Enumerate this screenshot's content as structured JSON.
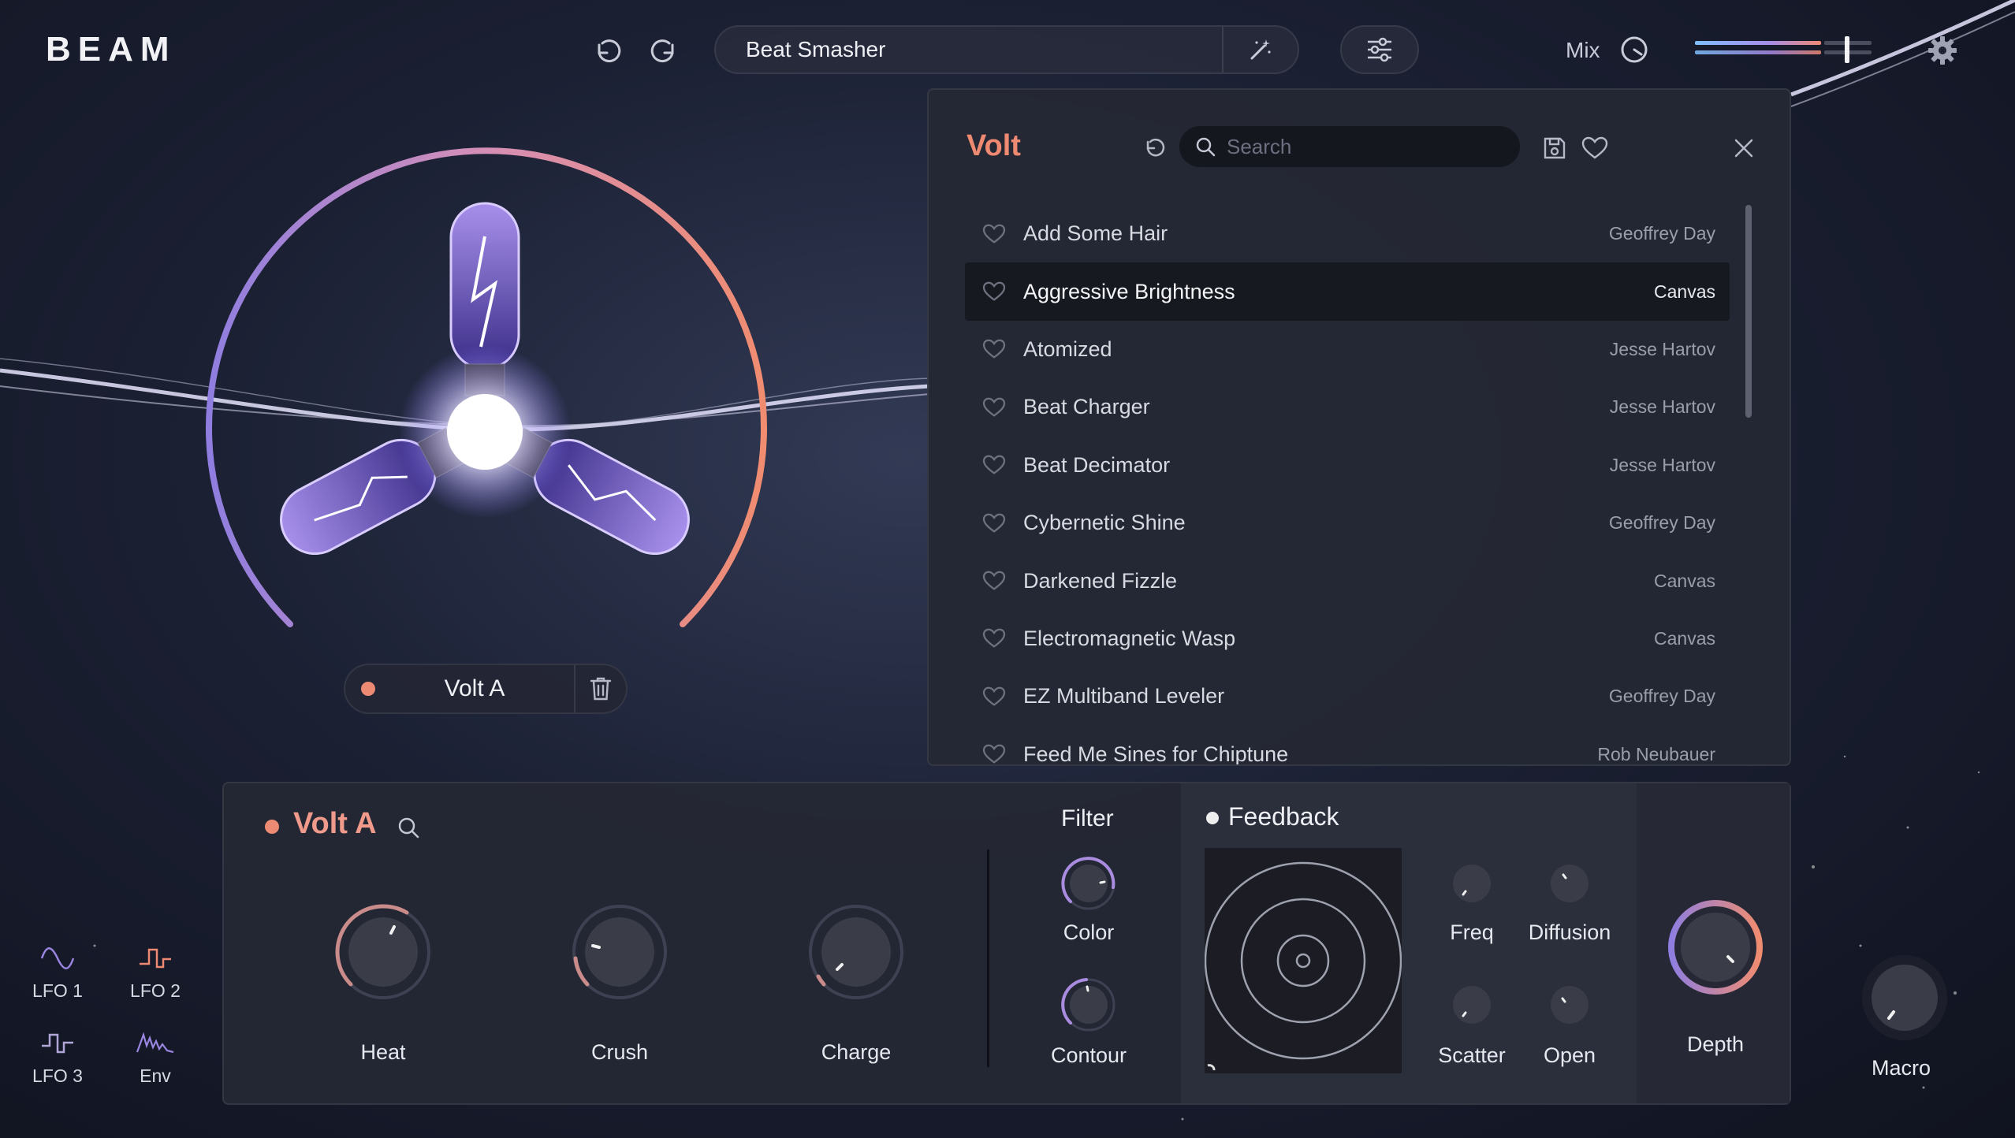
{
  "app": {
    "logo": "BEAM"
  },
  "topbar": {
    "preset_name": "Beat Smasher",
    "mix_label": "Mix"
  },
  "visualizer": {
    "module_chip": "Volt A"
  },
  "browser": {
    "title": "Volt",
    "search_placeholder": "Search",
    "items": [
      {
        "name": "Add Some Hair",
        "author": "Geoffrey Day"
      },
      {
        "name": "Aggressive Brightness",
        "author": "Canvas"
      },
      {
        "name": "Atomized",
        "author": "Jesse Hartov"
      },
      {
        "name": "Beat Charger",
        "author": "Jesse Hartov"
      },
      {
        "name": "Beat Decimator",
        "author": "Jesse Hartov"
      },
      {
        "name": "Cybernetic Shine",
        "author": "Geoffrey Day"
      },
      {
        "name": "Darkened Fizzle",
        "author": "Canvas"
      },
      {
        "name": "Electromagnetic Wasp",
        "author": "Canvas"
      },
      {
        "name": "EZ Multiband Leveler",
        "author": "Geoffrey Day"
      },
      {
        "name": "Feed Me Sines for Chiptune",
        "author": "Rob Neubauer"
      }
    ],
    "selected_index": 1
  },
  "module": {
    "title": "Volt A",
    "knobs": {
      "heat": "Heat",
      "crush": "Crush",
      "charge": "Charge"
    },
    "filter": {
      "title": "Filter",
      "color": "Color",
      "contour": "Contour"
    },
    "feedback": {
      "title": "Feedback",
      "freq": "Freq",
      "diffusion": "Diffusion",
      "scatter": "Scatter",
      "open": "Open"
    },
    "depth": "Depth"
  },
  "macro": "Macro",
  "dock": {
    "lfo1": "LFO 1",
    "lfo2": "LFO 2",
    "lfo3": "LFO 3",
    "env": "Env"
  },
  "colors": {
    "accent": "#ef8a72",
    "accent_purple": "#9a86e0",
    "panel": "#24273a"
  }
}
